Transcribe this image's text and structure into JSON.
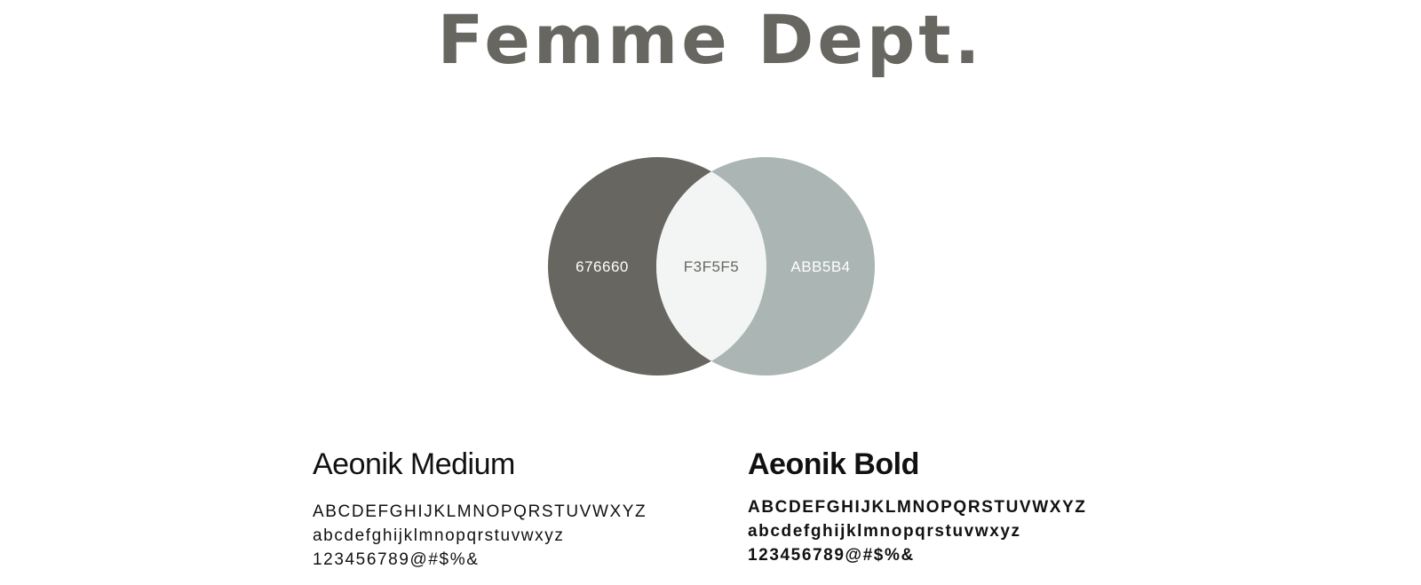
{
  "brand": {
    "title": "Femme Dept."
  },
  "palette": {
    "swatches": [
      {
        "name": "swatch-dark",
        "label": "676660",
        "color": "#676660",
        "text_color": "#ffffff"
      },
      {
        "name": "swatch-light",
        "label": "F3F5F5",
        "color": "#F3F5F5",
        "text_color": "#676660"
      },
      {
        "name": "swatch-grey",
        "label": "ABB5B4",
        "color": "#ABB5B4",
        "text_color": "#ffffff"
      }
    ]
  },
  "typography": {
    "medium": {
      "name": "Aeonik Medium",
      "uppercase": "ABCDEFGHIJKLMNOPQRSTUVWXYZ",
      "lowercase": "abcdefghijklmnopqrstuvwxyz",
      "numerals": "123456789@#$%&"
    },
    "bold": {
      "name": "Aeonik Bold",
      "uppercase": "ABCDEFGHIJKLMNOPQRSTUVWXYZ",
      "lowercase": "abcdefghijklmnopqrstuvwxyz",
      "numerals": "123456789@#$%&"
    }
  }
}
